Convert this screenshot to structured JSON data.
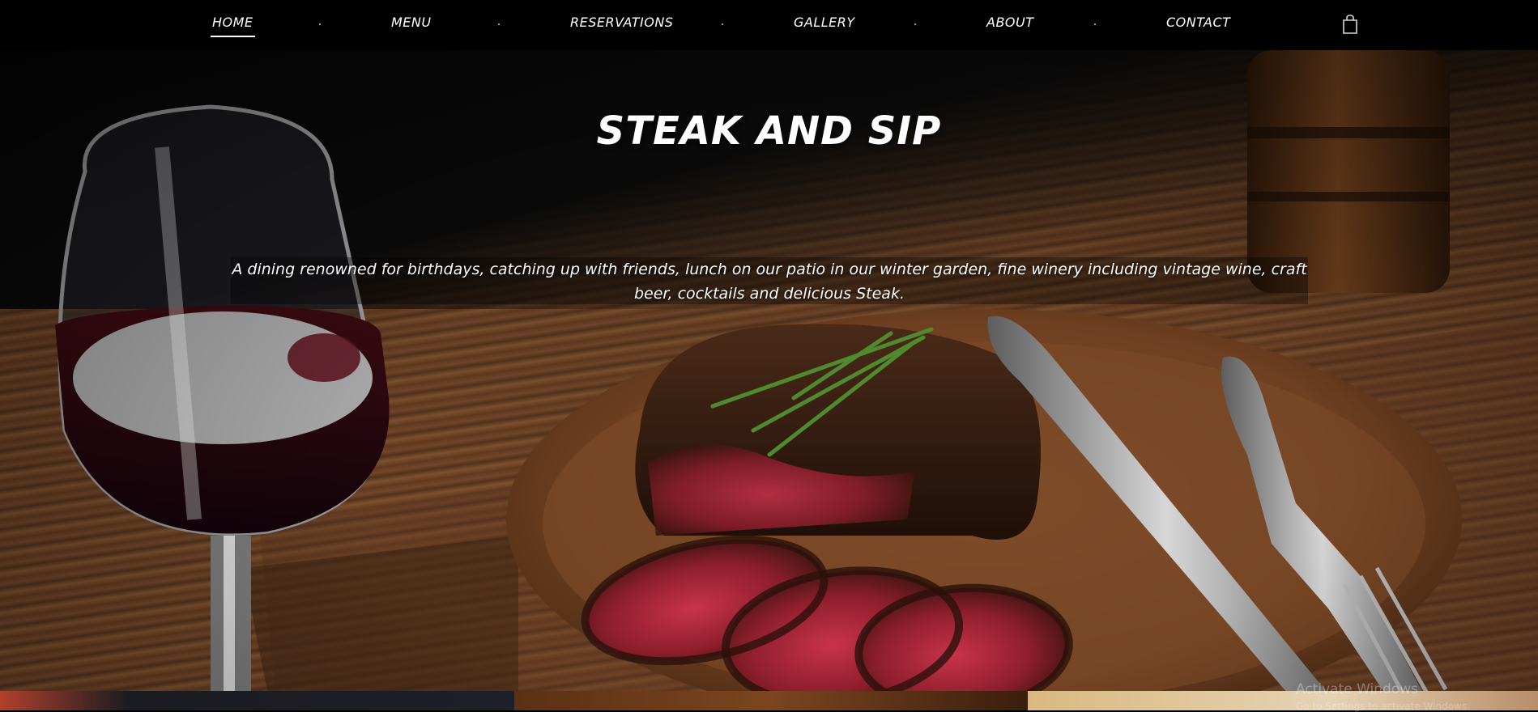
{
  "nav": {
    "items": [
      {
        "label": "HOME",
        "active": true
      },
      {
        "label": "MENU",
        "active": false
      },
      {
        "label": "RESERVATIONS",
        "active": false
      },
      {
        "label": "GALLERY",
        "active": false
      },
      {
        "label": "ABOUT",
        "active": false
      },
      {
        "label": "CONTACT",
        "active": false
      }
    ],
    "cart_icon": "shopping-bag-icon"
  },
  "hero": {
    "title": "STEAK AND SIP",
    "description": "A dining renowned for birthdays, catching up with friends, lunch on our patio in our winter garden, fine winery including vintage wine, craft beer, cocktails and delicious Steak."
  },
  "watermark": {
    "title": "Activate Windows",
    "subtitle": "Go to Settings to activate Windows."
  }
}
